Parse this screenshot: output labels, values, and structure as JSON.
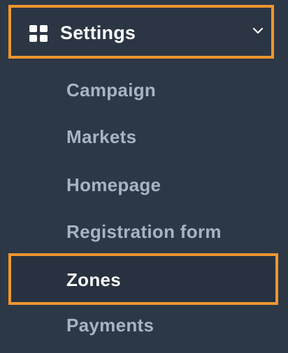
{
  "menu": {
    "section_title": "Settings",
    "section_icon": "grid-icon",
    "expand_icon": "chevron-down-icon",
    "items": [
      {
        "label": "Campaign",
        "active": false
      },
      {
        "label": "Markets",
        "active": false
      },
      {
        "label": "Homepage",
        "active": false
      },
      {
        "label": "Registration form",
        "active": false
      },
      {
        "label": "Zones",
        "active": true
      },
      {
        "label": "Payments",
        "active": false
      }
    ]
  },
  "colors": {
    "background": "#2d3847",
    "highlight_border": "#f0962f",
    "active_text": "#ffffff",
    "inactive_text": "#a9b3c1"
  }
}
